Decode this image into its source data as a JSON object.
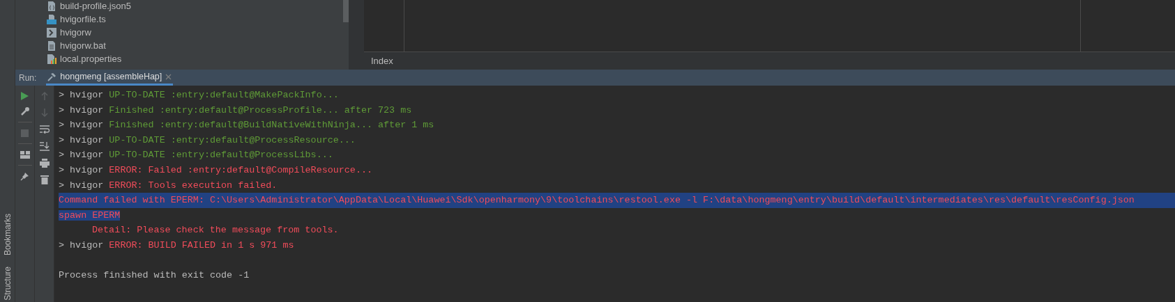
{
  "project_tree": {
    "items": [
      {
        "name": "build-profile.json5",
        "kind": "json"
      },
      {
        "name": "hvigorfile.ts",
        "kind": "ts"
      },
      {
        "name": "hvigorw",
        "kind": "script"
      },
      {
        "name": "hvigorw.bat",
        "kind": "text"
      },
      {
        "name": "local.properties",
        "kind": "properties"
      }
    ]
  },
  "editor_tabs": [
    {
      "label": "Index"
    }
  ],
  "run_panel": {
    "label": "Run:",
    "tabs": [
      {
        "label": "hongmeng [assembleHap]",
        "selected": true
      }
    ]
  },
  "side_tabs": [
    {
      "label": "Bookmarks"
    },
    {
      "label": "Structure"
    }
  ],
  "console": {
    "lines": [
      {
        "prefix": "> hvigor",
        "text": "UP-TO-DATE :entry:default@MakePackInfo...",
        "kind": "success",
        "selected": false
      },
      {
        "prefix": "> hvigor",
        "text": "Finished :entry:default@ProcessProfile... after 723 ms",
        "kind": "success",
        "selected": false
      },
      {
        "prefix": "> hvigor",
        "text": "Finished :entry:default@BuildNativeWithNinja... after 1 ms",
        "kind": "success",
        "selected": false
      },
      {
        "prefix": "> hvigor",
        "text": "UP-TO-DATE :entry:default@ProcessResource...",
        "kind": "success",
        "selected": false
      },
      {
        "prefix": "> hvigor",
        "text": "UP-TO-DATE :entry:default@ProcessLibs...",
        "kind": "success",
        "selected": false
      },
      {
        "prefix": "> hvigor",
        "text": "ERROR: Failed :entry:default@CompileResource...",
        "kind": "error",
        "selected": false
      },
      {
        "prefix": "> hvigor",
        "text": "ERROR: Tools execution failed.",
        "kind": "error",
        "selected": false
      },
      {
        "text": "Command failed with EPERM: C:\\Users\\Administrator\\AppData\\Local\\Huawei\\Sdk\\openharmony\\9\\toolchains\\restool.exe -l F:\\data\\hongmeng\\entry\\build\\default\\intermediates\\res\\default\\resConfig.json",
        "kind": "error",
        "selected": true
      },
      {
        "text": "spawn EPERM",
        "kind": "error",
        "selected": true
      },
      {
        "text": "Detail: Please check the message from tools.",
        "kind": "error",
        "selected": false,
        "indented": true
      },
      {
        "prefix": "> hvigor",
        "text": "ERROR: BUILD FAILED in 1 s 971 ms",
        "kind": "error",
        "selected": false
      },
      {
        "text": "Process finished with exit code -1",
        "kind": "plain",
        "selected": false,
        "gap_before": true
      }
    ]
  }
}
